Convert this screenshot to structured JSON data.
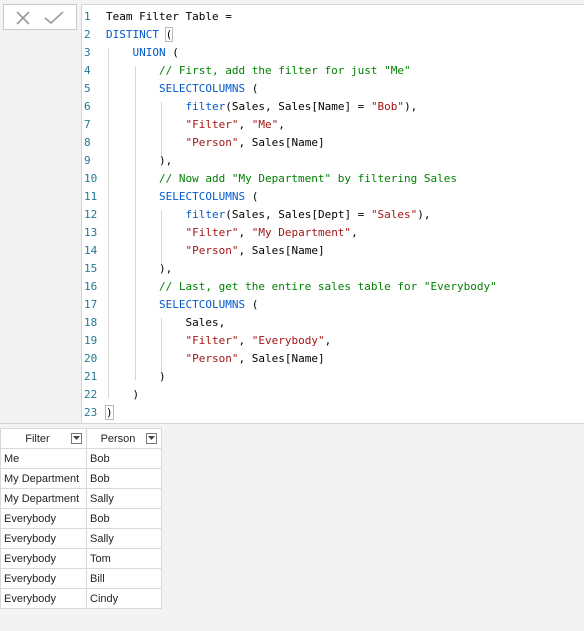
{
  "commit_box": {
    "cancel_icon": "x-icon",
    "confirm_icon": "checkmark-icon"
  },
  "editor": {
    "lines": [
      {
        "n": "1",
        "t": [
          [
            "k-blk",
            "Team Filter Table ="
          ]
        ]
      },
      {
        "n": "2",
        "t": [
          [
            "k-blue",
            "DISTINCT"
          ],
          [
            "k-blk",
            " "
          ],
          [
            "k-blk",
            "("
          ]
        ]
      },
      {
        "n": "3",
        "t": [
          [
            "k-blk",
            "    "
          ],
          [
            "k-blue",
            "UNION"
          ],
          [
            "k-blk",
            " ("
          ]
        ]
      },
      {
        "n": "4",
        "t": [
          [
            "k-blk",
            "        "
          ],
          [
            "k-com",
            "// First, add the filter for just \"Me\""
          ]
        ]
      },
      {
        "n": "5",
        "t": [
          [
            "k-blk",
            "        "
          ],
          [
            "k-blue",
            "SELECTCOLUMNS"
          ],
          [
            "k-blk",
            " ("
          ]
        ]
      },
      {
        "n": "6",
        "t": [
          [
            "k-blk",
            "            "
          ],
          [
            "k-blue",
            "filter"
          ],
          [
            "k-blk",
            "(Sales, Sales[Name] = "
          ],
          [
            "k-str",
            "\"Bob\""
          ],
          [
            "k-blk",
            "),"
          ]
        ]
      },
      {
        "n": "7",
        "t": [
          [
            "k-blk",
            "            "
          ],
          [
            "k-str",
            "\"Filter\""
          ],
          [
            "k-blk",
            ", "
          ],
          [
            "k-str",
            "\"Me\""
          ],
          [
            "k-blk",
            ","
          ]
        ]
      },
      {
        "n": "8",
        "t": [
          [
            "k-blk",
            "            "
          ],
          [
            "k-str",
            "\"Person\""
          ],
          [
            "k-blk",
            ", Sales[Name]"
          ]
        ]
      },
      {
        "n": "9",
        "t": [
          [
            "k-blk",
            "        ),"
          ]
        ]
      },
      {
        "n": "10",
        "t": [
          [
            "k-blk",
            "        "
          ],
          [
            "k-com",
            "// Now add \"My Department\" by filtering Sales"
          ]
        ]
      },
      {
        "n": "11",
        "t": [
          [
            "k-blk",
            "        "
          ],
          [
            "k-blue",
            "SELECTCOLUMNS"
          ],
          [
            "k-blk",
            " ("
          ]
        ]
      },
      {
        "n": "12",
        "t": [
          [
            "k-blk",
            "            "
          ],
          [
            "k-blue",
            "filter"
          ],
          [
            "k-blk",
            "(Sales, Sales[Dept] = "
          ],
          [
            "k-str",
            "\"Sales\""
          ],
          [
            "k-blk",
            "),"
          ]
        ]
      },
      {
        "n": "13",
        "t": [
          [
            "k-blk",
            "            "
          ],
          [
            "k-str",
            "\"Filter\""
          ],
          [
            "k-blk",
            ", "
          ],
          [
            "k-str",
            "\"My Department\""
          ],
          [
            "k-blk",
            ","
          ]
        ]
      },
      {
        "n": "14",
        "t": [
          [
            "k-blk",
            "            "
          ],
          [
            "k-str",
            "\"Person\""
          ],
          [
            "k-blk",
            ", Sales[Name]"
          ]
        ]
      },
      {
        "n": "15",
        "t": [
          [
            "k-blk",
            "        ),"
          ]
        ]
      },
      {
        "n": "16",
        "t": [
          [
            "k-blk",
            "        "
          ],
          [
            "k-com",
            "// Last, get the entire sales table for \"Everybody\""
          ]
        ]
      },
      {
        "n": "17",
        "t": [
          [
            "k-blk",
            "        "
          ],
          [
            "k-blue",
            "SELECTCOLUMNS"
          ],
          [
            "k-blk",
            " ("
          ]
        ]
      },
      {
        "n": "18",
        "t": [
          [
            "k-blk",
            "            Sales,"
          ]
        ]
      },
      {
        "n": "19",
        "t": [
          [
            "k-blk",
            "            "
          ],
          [
            "k-str",
            "\"Filter\""
          ],
          [
            "k-blk",
            ", "
          ],
          [
            "k-str",
            "\"Everybody\""
          ],
          [
            "k-blk",
            ","
          ]
        ]
      },
      {
        "n": "20",
        "t": [
          [
            "k-blk",
            "            "
          ],
          [
            "k-str",
            "\"Person\""
          ],
          [
            "k-blk",
            ", Sales[Name]"
          ]
        ]
      },
      {
        "n": "21",
        "t": [
          [
            "k-blk",
            "        )"
          ]
        ]
      },
      {
        "n": "22",
        "t": [
          [
            "k-blk",
            "    )"
          ]
        ]
      },
      {
        "n": "23",
        "t": [
          [
            "k-blk",
            ")"
          ]
        ]
      }
    ]
  },
  "table": {
    "columns": [
      "Filter",
      "Person"
    ],
    "rows": [
      [
        "Me",
        "Bob"
      ],
      [
        "My Department",
        "Bob"
      ],
      [
        "My Department",
        "Sally"
      ],
      [
        "Everybody",
        "Bob"
      ],
      [
        "Everybody",
        "Sally"
      ],
      [
        "Everybody",
        "Tom"
      ],
      [
        "Everybody",
        "Bill"
      ],
      [
        "Everybody",
        "Cindy"
      ]
    ],
    "filter_dropdown_icon": "chevron-down-icon"
  }
}
